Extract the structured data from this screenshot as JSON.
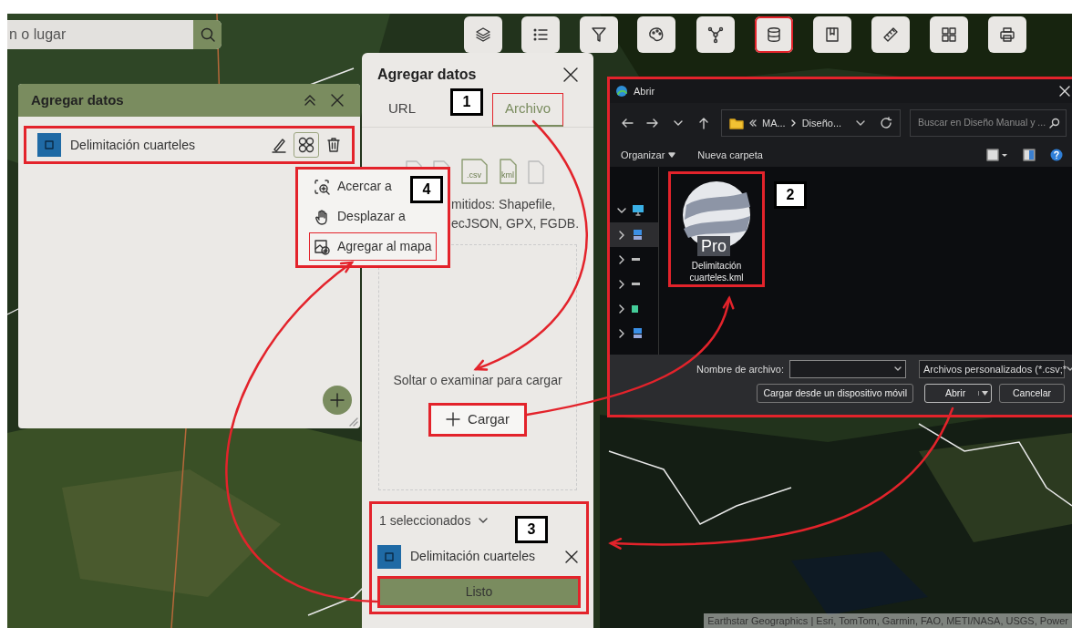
{
  "search": {
    "placeholder": "n o lugar"
  },
  "toolbar": [
    {
      "kind": "layers",
      "selected": false
    },
    {
      "kind": "list",
      "selected": false
    },
    {
      "kind": "filter",
      "selected": false
    },
    {
      "kind": "palette",
      "selected": false
    },
    {
      "kind": "network",
      "selected": false
    },
    {
      "kind": "database",
      "selected": true
    },
    {
      "kind": "bookmark",
      "selected": false
    },
    {
      "kind": "ruler",
      "selected": false
    },
    {
      "kind": "grid",
      "selected": false
    },
    {
      "kind": "print",
      "selected": false
    }
  ],
  "layer_panel": {
    "title": "Agregar datos",
    "items": [
      {
        "name": "Delimitación cuarteles",
        "color": "#1f6aa5"
      }
    ],
    "menu": [
      {
        "kind": "zoom",
        "label": "Acercar a",
        "selected": false
      },
      {
        "kind": "pan",
        "label": "Desplazar a",
        "selected": false
      },
      {
        "kind": "add",
        "label": "Agregar al mapa",
        "selected": true
      }
    ]
  },
  "add_panel": {
    "title": "Agregar datos",
    "tabs": [
      {
        "label": "URL",
        "selected": false
      },
      {
        "label": "Archivo",
        "selected": true
      }
    ],
    "file_icons": [
      {
        "kind": "plain"
      },
      {
        "kind": "geo"
      },
      {
        "kind": "labeled",
        "label": ".csv"
      },
      {
        "kind": "labeled",
        "label": "kml"
      },
      {
        "kind": "plain"
      }
    ],
    "supported_lines": [
      "mitidos: Shapefile,",
      "ecJSON, GPX, FGDB."
    ],
    "drop_text": "Soltar o examinar para cargar",
    "upload_button": "Cargar",
    "selection_label": "1 seleccionados",
    "selected_items": [
      {
        "name": "Delimitación cuarteles",
        "color": "#1f6aa5"
      }
    ],
    "done_button": "Listo"
  },
  "dialog": {
    "title": "Abrir",
    "breadcrumb": [
      "MA...",
      "Diseño..."
    ],
    "search_placeholder": "Buscar en Diseño Manual y ...",
    "toolbar": [
      "Organizar",
      "Nueva carpeta"
    ],
    "nav_items": [
      {
        "kind": "pc",
        "expanded": true,
        "selected": false
      },
      {
        "kind": "network",
        "expanded": false,
        "selected": true
      },
      {
        "kind": "drive",
        "expanded": false,
        "selected": false
      },
      {
        "kind": "drive",
        "expanded": false,
        "selected": false
      },
      {
        "kind": "usb",
        "expanded": false,
        "selected": false
      },
      {
        "kind": "network",
        "expanded": false,
        "selected": false
      }
    ],
    "file": {
      "name": "Delimitación cuarteles.kml",
      "badge": "Pro"
    },
    "filename_label": "Nombre de archivo:",
    "filter": "Archivos personalizados (*.csv;*",
    "mobile_button": "Cargar desde un dispositivo móvil",
    "open_button": "Abrir",
    "cancel_button": "Cancelar"
  },
  "callouts": [
    "1",
    "2",
    "3",
    "4"
  ],
  "attribution": "Earthstar Geographics | Esri, TomTom, Garmin, FAO, METI/NASA, USGS, Power"
}
